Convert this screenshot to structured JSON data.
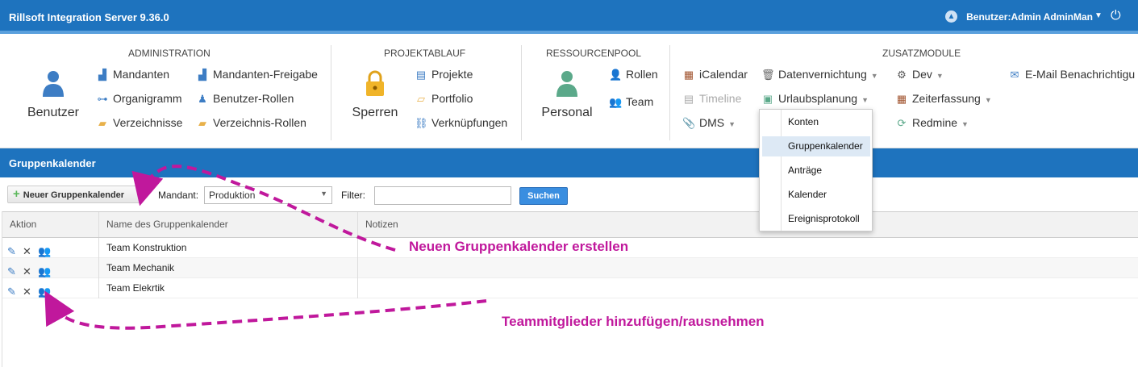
{
  "header": {
    "app_title": "Rillsoft Integration Server 9.36.0",
    "user_label": "Benutzer:Admin AdminMan"
  },
  "ribbon": {
    "administration": {
      "title": "ADMINISTRATION",
      "big_button": "Benutzer",
      "items": [
        "Mandanten",
        "Organigramm",
        "Verzeichnisse",
        "Mandanten-Freigabe",
        "Benutzer-Rollen",
        "Verzeichnis-Rollen"
      ]
    },
    "projektablauf": {
      "title": "PROJEKTABLAUF",
      "big_button": "Sperren",
      "items": [
        "Projekte",
        "Portfolio",
        "Verknüpfungen"
      ]
    },
    "ressourcenpool": {
      "title": "RESSOURCENPOOL",
      "big_button": "Personal",
      "items": [
        "Rollen",
        "Team"
      ]
    },
    "zusatzmodule": {
      "title": "ZUSATZMODULE",
      "items": [
        "iCalendar",
        "Timeline",
        "DMS",
        "Datenvernichtung",
        "Urlaubsplanung",
        "Dev",
        "Zeiterfassung",
        "Redmine",
        "E-Mail Benachrichtigu"
      ]
    }
  },
  "dropdown": {
    "options": [
      "Konten",
      "Gruppenkalender",
      "Anträge",
      "Kalender",
      "Ereignisprotokoll"
    ],
    "selected": "Gruppenkalender"
  },
  "section": {
    "title": "Gruppenkalender"
  },
  "toolbar": {
    "new_button": "Neuer Gruppenkalender",
    "mandant_label": "Mandant:",
    "mandant_value": "Produktion",
    "filter_label": "Filter:",
    "filter_value": "",
    "search_button": "Suchen"
  },
  "table": {
    "columns": [
      "Aktion",
      "Name des Gruppenkalender",
      "Notizen"
    ],
    "rows": [
      {
        "name": "Team Konstruktion",
        "notes": ""
      },
      {
        "name": "Team Mechanik",
        "notes": ""
      },
      {
        "name": "Team Elekrtik",
        "notes": ""
      }
    ]
  },
  "annotations": {
    "new_calendar": "Neuen Gruppenkalender erstellen",
    "members": "Teammitglieder hinzufügen/rausnehmen"
  },
  "colors": {
    "header_blue": "#1e73be",
    "annotation_magenta": "#c0189c",
    "dropdown_selected": "#dde9f5"
  }
}
